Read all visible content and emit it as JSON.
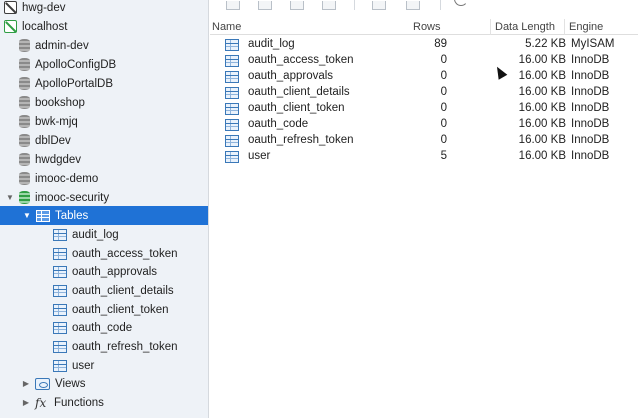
{
  "sidebar": {
    "connections": [
      {
        "label": "hwg-dev"
      },
      {
        "label": "localhost"
      }
    ],
    "databases": [
      {
        "label": "admin-dev"
      },
      {
        "label": "ApolloConfigDB"
      },
      {
        "label": "ApolloPortalDB"
      },
      {
        "label": "bookshop"
      },
      {
        "label": "bwk-mjq"
      },
      {
        "label": "dblDev"
      },
      {
        "label": "hwdgdev"
      },
      {
        "label": "imooc-demo"
      },
      {
        "label": "imooc-security"
      }
    ],
    "tables_group": {
      "label": "Tables"
    },
    "tables": [
      {
        "label": "audit_log"
      },
      {
        "label": "oauth_access_token"
      },
      {
        "label": "oauth_approvals"
      },
      {
        "label": "oauth_client_details"
      },
      {
        "label": "oauth_client_token"
      },
      {
        "label": "oauth_code"
      },
      {
        "label": "oauth_refresh_token"
      },
      {
        "label": "user"
      }
    ],
    "views_group": {
      "label": "Views"
    },
    "functions_group": {
      "label": "Functions"
    }
  },
  "table_list": {
    "columns": {
      "name": "Name",
      "rows": "Rows",
      "data_length": "Data Length",
      "engine": "Engine"
    },
    "rows": [
      {
        "name": "audit_log",
        "rows": "89",
        "data_length": "5.22 KB",
        "engine": "MyISAM"
      },
      {
        "name": "oauth_access_token",
        "rows": "0",
        "data_length": "16.00 KB",
        "engine": "InnoDB"
      },
      {
        "name": "oauth_approvals",
        "rows": "0",
        "data_length": "16.00 KB",
        "engine": "InnoDB"
      },
      {
        "name": "oauth_client_details",
        "rows": "0",
        "data_length": "16.00 KB",
        "engine": "InnoDB"
      },
      {
        "name": "oauth_client_token",
        "rows": "0",
        "data_length": "16.00 KB",
        "engine": "InnoDB"
      },
      {
        "name": "oauth_code",
        "rows": "0",
        "data_length": "16.00 KB",
        "engine": "InnoDB"
      },
      {
        "name": "oauth_refresh_token",
        "rows": "0",
        "data_length": "16.00 KB",
        "engine": "InnoDB"
      },
      {
        "name": "user",
        "rows": "5",
        "data_length": "16.00 KB",
        "engine": "InnoDB"
      }
    ]
  },
  "icons": {
    "connection": "connection-icon",
    "database": "database-icon",
    "table": "table-icon",
    "views": "views-icon",
    "functions": "functions-icon",
    "refresh": "refresh-icon"
  },
  "colors": {
    "selection": "#1f72d6",
    "sidebar_bg": "#eef2f7",
    "active_connection": "#2f9e44"
  }
}
